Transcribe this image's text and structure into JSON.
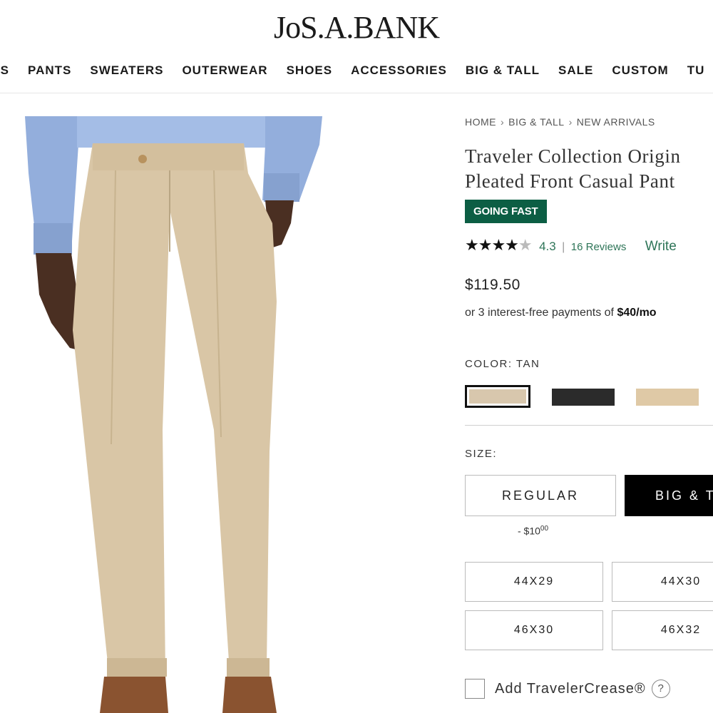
{
  "header": {
    "logo": "JoS.A.BANK",
    "nav": [
      "RTS",
      "PANTS",
      "SWEATERS",
      "OUTERWEAR",
      "SHOES",
      "ACCESSORIES",
      "BIG & TALL",
      "SALE",
      "CUSTOM",
      "TU"
    ]
  },
  "breadcrumb": [
    "HOME",
    "BIG & TALL",
    "NEW ARRIVALS"
  ],
  "product": {
    "title_line1": "Traveler Collection Origin",
    "title_line2": "Pleated Front Casual Pant",
    "badge": "GOING FAST",
    "rating": "4.3",
    "stars": "★★★★",
    "half_star": "★",
    "rating_separator": "|",
    "reviews": "16 Reviews",
    "write_review": "Write",
    "price": "$119.50",
    "installments_text": "or 3 interest-free payments of ",
    "installments_amount": "$40/mo"
  },
  "color": {
    "label": "COLOR: TAN",
    "swatches": [
      {
        "name": "tan",
        "hex": "#d8c7ad",
        "selected": true
      },
      {
        "name": "black",
        "hex": "#2b2b2b",
        "selected": false
      },
      {
        "name": "khaki",
        "hex": "#dfc9a6",
        "selected": false
      }
    ]
  },
  "size": {
    "label": "SIZE:",
    "fits": [
      "REGULAR",
      "BIG & T"
    ],
    "selected_fit": "BIG & T",
    "price_diff_prefix": "- $10",
    "price_diff_cents": "00",
    "options": [
      "44X29",
      "44X30",
      "46X30",
      "46X32"
    ]
  },
  "addon": {
    "label": "Add TravelerCrease®",
    "help": "?"
  },
  "colors": {
    "badge_green": "#0c5e44",
    "link_green": "#2e7558",
    "pants_tan": "#d9c6a6",
    "shirt_blue": "#93aedc"
  }
}
